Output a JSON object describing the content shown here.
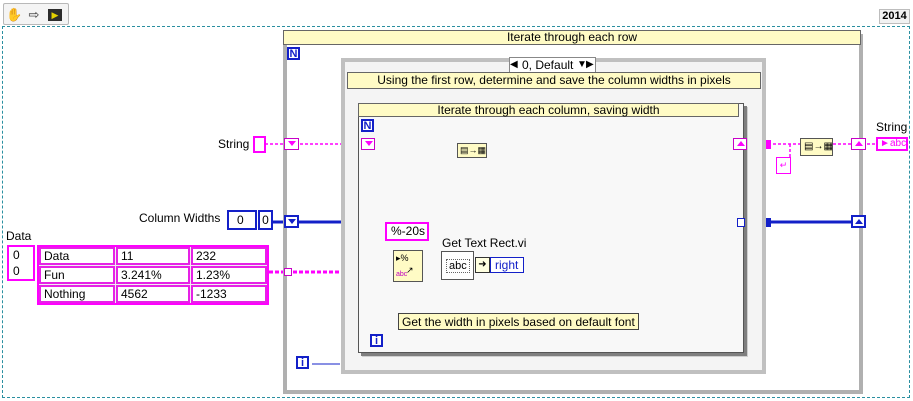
{
  "toolbar": {
    "year": "2014"
  },
  "labels": {
    "data": "Data",
    "string_in": "String",
    "column_widths": "Column Widths",
    "string_out": "String",
    "get_text_rect": "Get Text Rect.vi",
    "format_string": "%-20s",
    "right": "right",
    "abc": "abc"
  },
  "loops": {
    "outer_title": "Iterate through each row",
    "outer_count": "N",
    "case_selector": "0, Default",
    "case_title": "Using the first row, determine and save the column widths in pixels",
    "inner_title": "Iterate through each column, saving width",
    "inner_count": "N",
    "iteration": "i"
  },
  "index_values": {
    "data_row": "0",
    "data_col": "0",
    "col_widths_index": "0",
    "col_widths_value": "0"
  },
  "comment": "Get the width in pixels based on default font",
  "table": [
    [
      "Data",
      "11",
      "232"
    ],
    [
      "Fun",
      "3.241%",
      "1.23%"
    ],
    [
      "Nothing",
      "4562",
      "-1233"
    ]
  ]
}
